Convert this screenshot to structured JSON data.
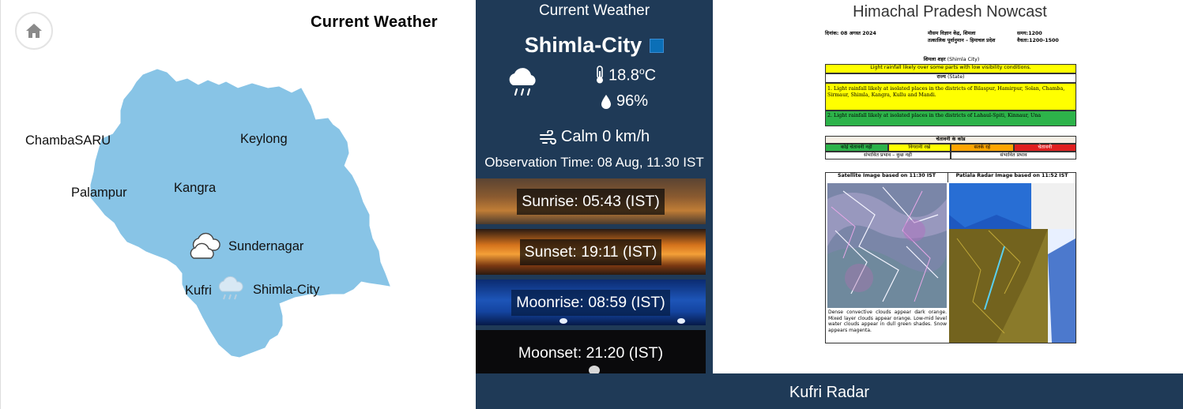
{
  "map": {
    "title": "Current Weather",
    "places": [
      "ChambaSARU",
      "Keylong",
      "Palampur",
      "Kangra",
      "Sundernagar",
      "Kufri",
      "Shimla-City"
    ]
  },
  "current": {
    "heading": "Current Weather",
    "city": "Shimla-City",
    "temperature_value": "18.8",
    "temperature_unit_sup": "o",
    "temperature_unit": "C",
    "humidity": "96%",
    "wind": "Calm 0 km/h",
    "observation_time": "Observation Time: 08 Aug, 11.30 IST",
    "sunrise": "Sunrise: 05:43 (IST)",
    "sunset": "Sunset: 19:11 (IST)",
    "moonrise": "Moonrise: 08:59 (IST)",
    "moonset": "Moonset: 21:20 (IST)",
    "colors": {
      "panel_bg": "#1f3a57",
      "map_fill": "#88c4e6",
      "city_marker": "#0b6fb7"
    }
  },
  "nowcast": {
    "title": "Himachal Pradesh Nowcast",
    "date_line": "दिनांक: 08 अगस्त 2024",
    "center_line1": "मौसम विज्ञान केंद्र, शिमला",
    "center_line2": "तत्कालिक पूर्वानुमान – हिमाचल प्रदेश",
    "time_line1": "समय:1200",
    "time_line2": "वैधता:1200-1500",
    "city_heading": "शिमला शहर",
    "city_heading_en": "(Shimla City)",
    "city_forecast": "Light rainfall likely over some parts with low visibility conditions.",
    "state_heading": "राज्य",
    "state_heading_en": "(State)",
    "state_item1": "1.  Light rainfall likely at isolated places in the districts of Bilaspur, Hamirpur, Solan, Chamba, Sirmaur, Shimla, Kangra, Kullu and Mandi.",
    "state_item2": "2.  Light rainfall likely at isolated places in the districts of Lahaul-Spiti, Kinnaur, Una",
    "warning_heading": "चेतावनी के कोड",
    "warning_codes": [
      "कोई चेतावनी नहीं",
      "निगरानी रखें",
      "सतर्क रहें",
      "चेतावनी"
    ],
    "impact_left": "संभावित प्रभाव – कुछ नहीं",
    "impact_right": "संभावित प्रभाव",
    "satellite_caption": "Satellite Image based on 11:30 IST",
    "radar_caption": "Patiala Radar Image based on 11:52 IST",
    "satellite_note": "Dense convective clouds appear dark orange. Mixed layer clouds appear orange. Low-mid level water clouds appear in dull green shades. Snow appears magenta."
  },
  "radar": {
    "title": "Kufri Radar"
  },
  "icons": [
    "home-icon",
    "cloud-icon",
    "cloud-rain-icon",
    "thermometer-icon",
    "droplet-icon",
    "wind-icon"
  ]
}
